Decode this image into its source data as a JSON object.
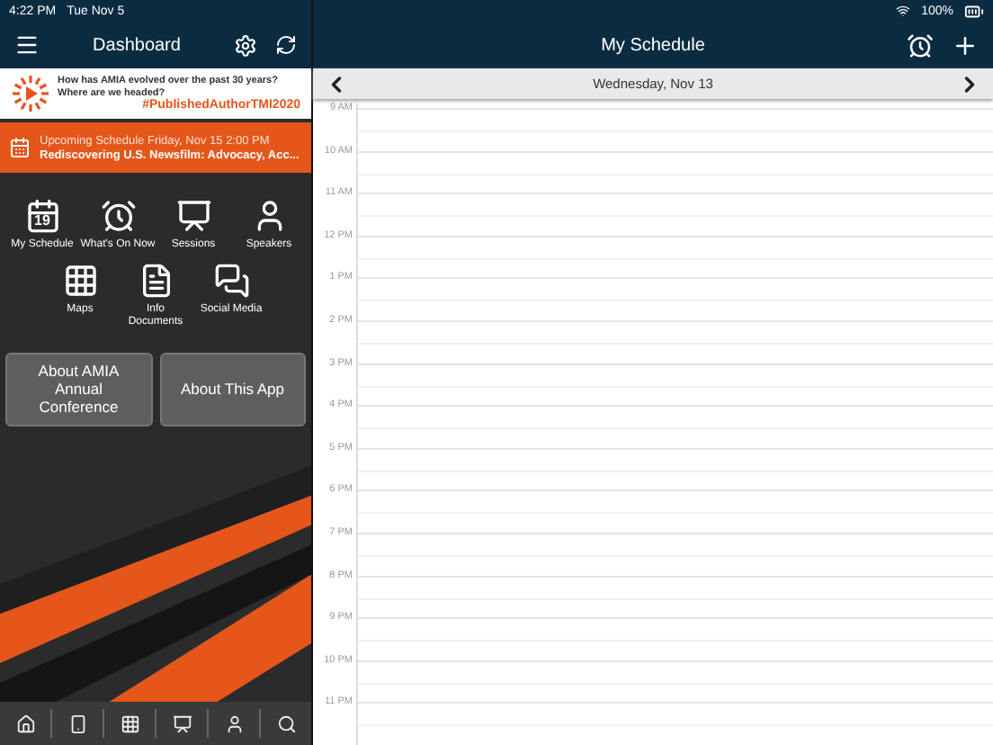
{
  "status_bar": {
    "time": "4:22 PM",
    "date": "Tue Nov 5",
    "battery": "100%"
  },
  "dashboard": {
    "title": "Dashboard"
  },
  "banner": {
    "question": "How has AMIA evolved over the past 30 years? Where are we headed?",
    "hashtag": "#PublishedAuthorTMI2020"
  },
  "upcoming": {
    "heading": "Upcoming Schedule Friday, Nov 15 2:00 PM",
    "session": "Rediscovering U.S. Newsfilm: Advocacy, Acc..."
  },
  "calendar_icon_day": "19",
  "tiles": [
    {
      "label": "My Schedule"
    },
    {
      "label": "What's On Now"
    },
    {
      "label": "Sessions"
    },
    {
      "label": "Speakers"
    },
    {
      "label": "Maps"
    },
    {
      "label": "Info Documents"
    },
    {
      "label": "Social Media"
    }
  ],
  "buttons": [
    "About AMIA Annual Conference",
    "About This App"
  ],
  "schedule": {
    "title": "My Schedule",
    "date": "Wednesday, Nov 13",
    "hours": [
      "9 AM",
      "10 AM",
      "11 AM",
      "12 PM",
      "1 PM",
      "2 PM",
      "3 PM",
      "4 PM",
      "5 PM",
      "6 PM",
      "7 PM",
      "8 PM",
      "9 PM",
      "10 PM",
      "11 PM"
    ]
  }
}
